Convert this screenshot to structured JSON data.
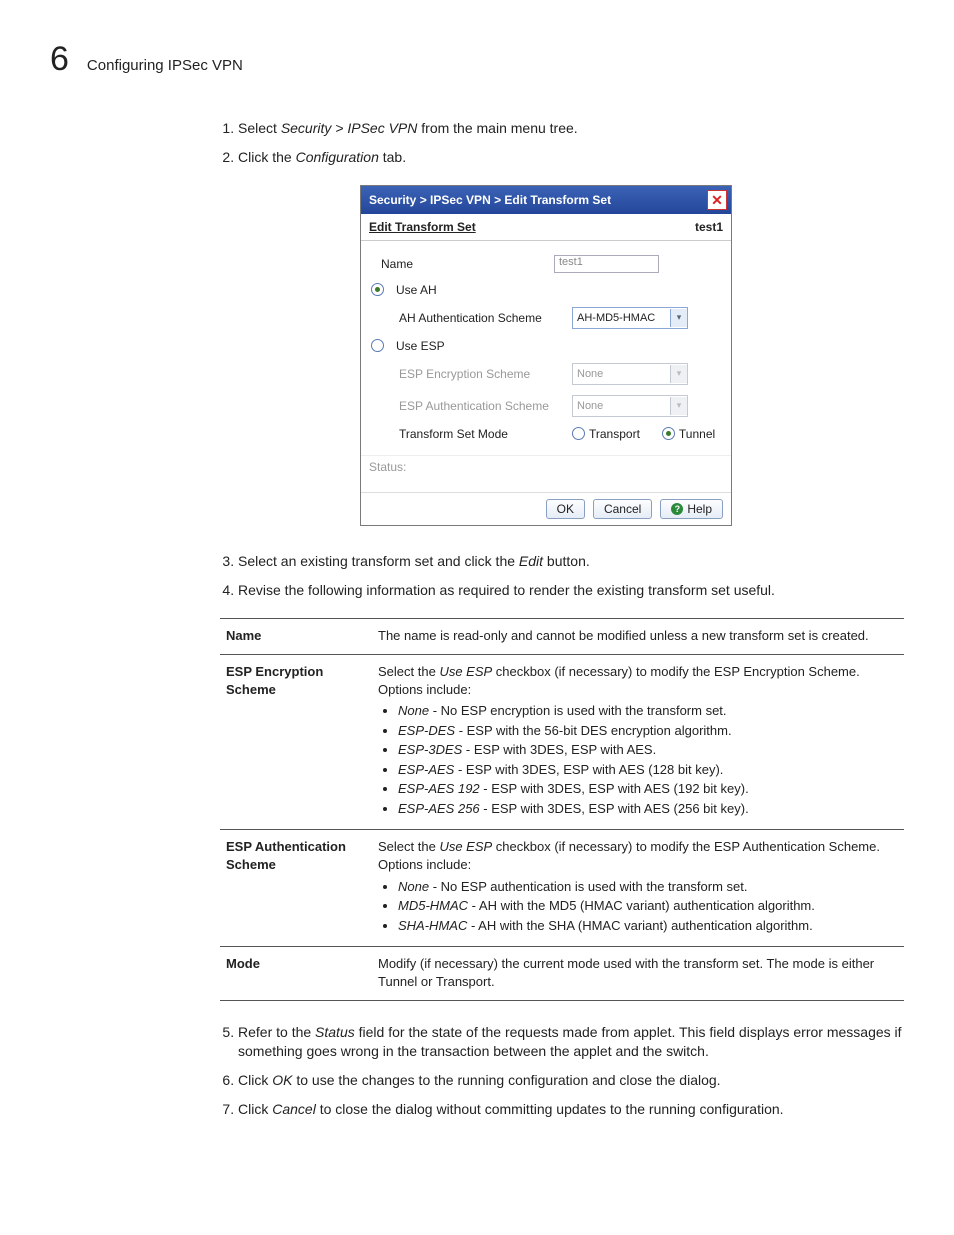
{
  "header": {
    "chapter_num": "6",
    "chapter_title": "Configuring IPSec VPN"
  },
  "steps_a": {
    "s1_pre": "Select ",
    "s1_path": "Security > IPSec VPN",
    "s1_post": " from the main menu tree.",
    "s2_pre": "Click the ",
    "s2_tab": "Configuration",
    "s2_post": " tab."
  },
  "dialog": {
    "title": "Security > IPSec VPN > Edit Transform Set",
    "sub_left": "Edit Transform Set",
    "sub_right": "test1",
    "name_label": "Name",
    "name_value": "test1",
    "use_ah": "Use AH",
    "ah_scheme_label": "AH Authentication Scheme",
    "ah_scheme_value": "AH-MD5-HMAC",
    "use_esp": "Use ESP",
    "esp_enc_label": "ESP Encryption Scheme",
    "esp_enc_value": "None",
    "esp_auth_label": "ESP Authentication Scheme",
    "esp_auth_value": "None",
    "tsm_label": "Transform Set Mode",
    "tsm_transport": "Transport",
    "tsm_tunnel": "Tunnel",
    "status": "Status:",
    "ok": "OK",
    "cancel": "Cancel",
    "help": "Help"
  },
  "steps_b": {
    "s3_pre": "Select an existing transform set and click the ",
    "s3_btn": "Edit",
    "s3_post": " button.",
    "s4": "Revise the following information as required to render the existing transform set useful."
  },
  "fields": {
    "name_h": "Name",
    "name_d": "The name is read-only and cannot be modified unless a new transform set is created.",
    "esp_enc_h": "ESP Encryption Scheme",
    "esp_enc_intro_pre": "Select the ",
    "esp_enc_intro_box": "Use ESP",
    "esp_enc_intro_post": " checkbox (if necessary) to modify the ESP Encryption Scheme. Options include:",
    "esp_enc_opts": [
      {
        "t": "None",
        "d": " - No ESP encryption is used with the transform set."
      },
      {
        "t": "ESP-DES",
        "d": " - ESP with the 56-bit DES encryption algorithm."
      },
      {
        "t": "ESP-3DES",
        "d": " - ESP with 3DES, ESP with AES."
      },
      {
        "t": "ESP-AES",
        "d": " - ESP with 3DES, ESP with AES (128 bit key)."
      },
      {
        "t": "ESP-AES 192",
        "d": " - ESP with 3DES, ESP with AES (192 bit key)."
      },
      {
        "t": "ESP-AES 256",
        "d": " - ESP with 3DES, ESP with AES (256 bit key)."
      }
    ],
    "esp_auth_h": "ESP Authentication Scheme",
    "esp_auth_intro_pre": "Select the ",
    "esp_auth_intro_box": "Use ESP",
    "esp_auth_intro_post": " checkbox (if necessary) to modify the ESP Authentication Scheme. Options include:",
    "esp_auth_opts": [
      {
        "t": "None",
        "d": " - No ESP authentication is used with the transform set."
      },
      {
        "t": "MD5-HMAC",
        "d": " - AH with the MD5 (HMAC variant) authentication algorithm."
      },
      {
        "t": "SHA-HMAC",
        "d": " - AH with the SHA (HMAC variant) authentication algorithm."
      }
    ],
    "mode_h": "Mode",
    "mode_d": "Modify (if necessary) the current mode used with the transform set. The mode is either Tunnel or Transport."
  },
  "steps_c": {
    "s5_pre": "Refer to the ",
    "s5_field": "Status",
    "s5_post": " field for the state of the requests made from applet. This field displays error messages if something goes wrong in the transaction between the applet and the switch.",
    "s6_pre": "Click ",
    "s6_btn": "OK",
    "s6_post": " to use the changes to the running configuration and close the dialog.",
    "s7_pre": "Click ",
    "s7_btn": "Cancel",
    "s7_post": " to close the dialog without committing updates to the running configuration."
  }
}
